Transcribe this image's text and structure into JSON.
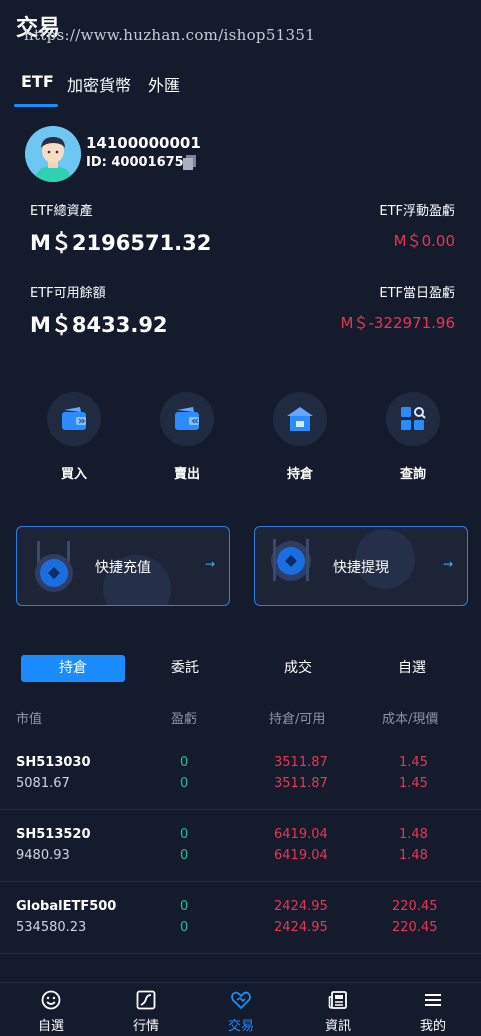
{
  "header": {
    "title": "交易",
    "watermark": "https://www.huzhan.com/ishop51351"
  },
  "top_tabs": [
    {
      "label": "ETF",
      "active": true
    },
    {
      "label": "加密貨幣",
      "active": false
    },
    {
      "label": "外匯",
      "active": false
    }
  ],
  "account": {
    "phone": "14100000001",
    "id_text": "ID:  40001675"
  },
  "stats": {
    "total_assets": {
      "label": "ETF總資產",
      "value": "M＄2196571.32"
    },
    "floating_pnl": {
      "label": "ETF浮動盈虧",
      "value": "M＄0.00"
    },
    "available": {
      "label": "ETF可用餘額",
      "value": "M＄8433.92"
    },
    "daily_pnl": {
      "label": "ETF當日盈虧",
      "value": "M＄-322971.96"
    }
  },
  "actions": [
    {
      "label": "買入",
      "icon": "wallet-in-icon"
    },
    {
      "label": "賣出",
      "icon": "wallet-out-icon"
    },
    {
      "label": "持倉",
      "icon": "store-icon"
    },
    {
      "label": "查詢",
      "icon": "grid-search-icon"
    }
  ],
  "quick": {
    "deposit": {
      "label": "快捷充值",
      "arrow": "→"
    },
    "withdraw": {
      "label": "快捷提現",
      "arrow": "→"
    }
  },
  "sub_tabs": [
    {
      "label": "持倉",
      "active": true
    },
    {
      "label": "委託",
      "active": false
    },
    {
      "label": "成交",
      "active": false
    },
    {
      "label": "自選",
      "active": false
    }
  ],
  "table": {
    "headers": [
      "市值",
      "盈虧",
      "持倉/可用",
      "成本/現價"
    ],
    "rows": [
      {
        "symbol": "SH513030",
        "market_value": "5081.67",
        "pnl1": "0",
        "pnl2": "0",
        "hold": "3511.87",
        "avail": "3511.87",
        "cost": "1.45",
        "price": "1.45"
      },
      {
        "symbol": "SH513520",
        "market_value": "9480.93",
        "pnl1": "0",
        "pnl2": "0",
        "hold": "6419.04",
        "avail": "6419.04",
        "cost": "1.48",
        "price": "1.48"
      },
      {
        "symbol": "GlobalETF500",
        "market_value": "534580.23",
        "pnl1": "0",
        "pnl2": "0",
        "hold": "2424.95",
        "avail": "2424.95",
        "cost": "220.45",
        "price": "220.45"
      }
    ]
  },
  "bottom_nav": [
    {
      "label": "自選",
      "icon": "smiley-icon",
      "active": false
    },
    {
      "label": "行情",
      "icon": "chart-icon",
      "active": false
    },
    {
      "label": "交易",
      "icon": "handshake-icon",
      "active": true
    },
    {
      "label": "資訊",
      "icon": "newspaper-icon",
      "active": false
    },
    {
      "label": "我的",
      "icon": "menu-icon",
      "active": false
    }
  ],
  "colors": {
    "accent": "#1a8cff",
    "loss": "#e8364f",
    "gain": "#19c39a",
    "background": "#141b2d"
  }
}
